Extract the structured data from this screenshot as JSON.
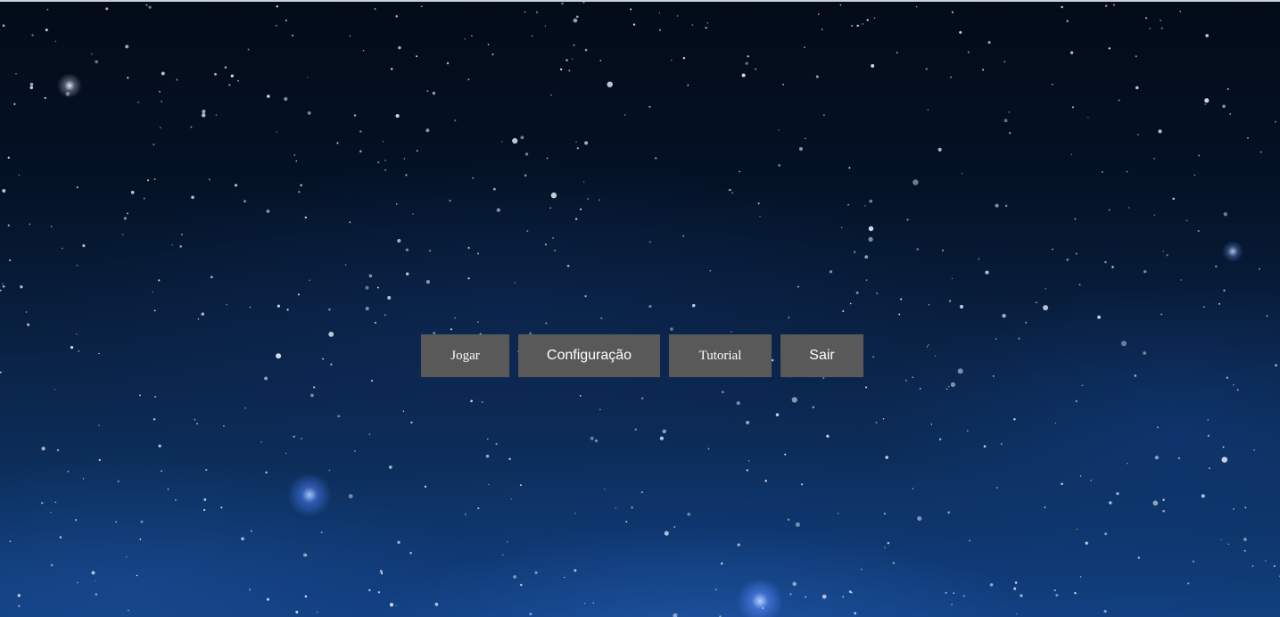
{
  "menu": {
    "play_label": "Jogar",
    "settings_label": "Configuração",
    "tutorial_label": "Tutorial",
    "exit_label": "Sair"
  },
  "background": {
    "scene": "starry-night-sky",
    "colors": {
      "sky_top": "#030b18",
      "sky_bottom": "#114080",
      "button_bg": "#595959",
      "button_text": "#ffffff"
    }
  }
}
